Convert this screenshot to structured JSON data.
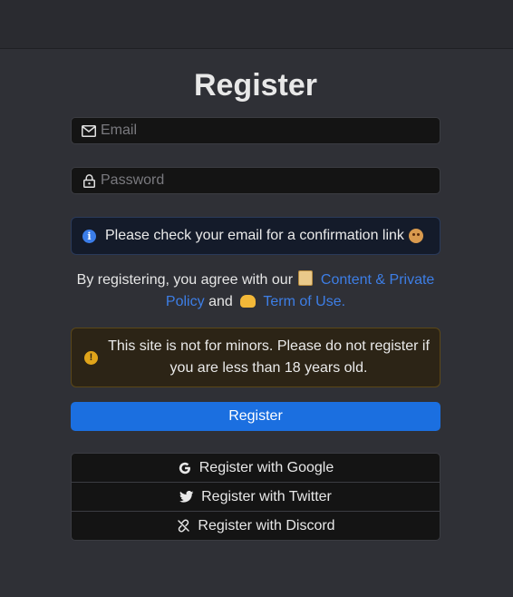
{
  "title": "Register",
  "email": {
    "placeholder": "Email",
    "icon": "envelope-icon"
  },
  "password": {
    "placeholder": "Password",
    "icon": "lock-icon"
  },
  "info_alert": {
    "text": "Please check your email for a confirmation link",
    "icon": "info-icon",
    "emoji": "sad-face-emoji"
  },
  "terms": {
    "prefix": "By registering, you agree with our",
    "content_policy_link": "Content & Private Policy",
    "and": "and",
    "terms_link": "Term of Use."
  },
  "warning_alert": {
    "text": "This site is not for minors. Please do not register if you are less than 18 years old.",
    "icon": "warning-icon"
  },
  "register_button": "Register",
  "social": {
    "google": "Register with Google",
    "twitter": "Register with Twitter",
    "discord": "Register with Discord"
  },
  "colors": {
    "background": "#2f3036",
    "primary": "#1b6fe0",
    "link": "#3d7ee6",
    "warning": "#e0a41a"
  }
}
